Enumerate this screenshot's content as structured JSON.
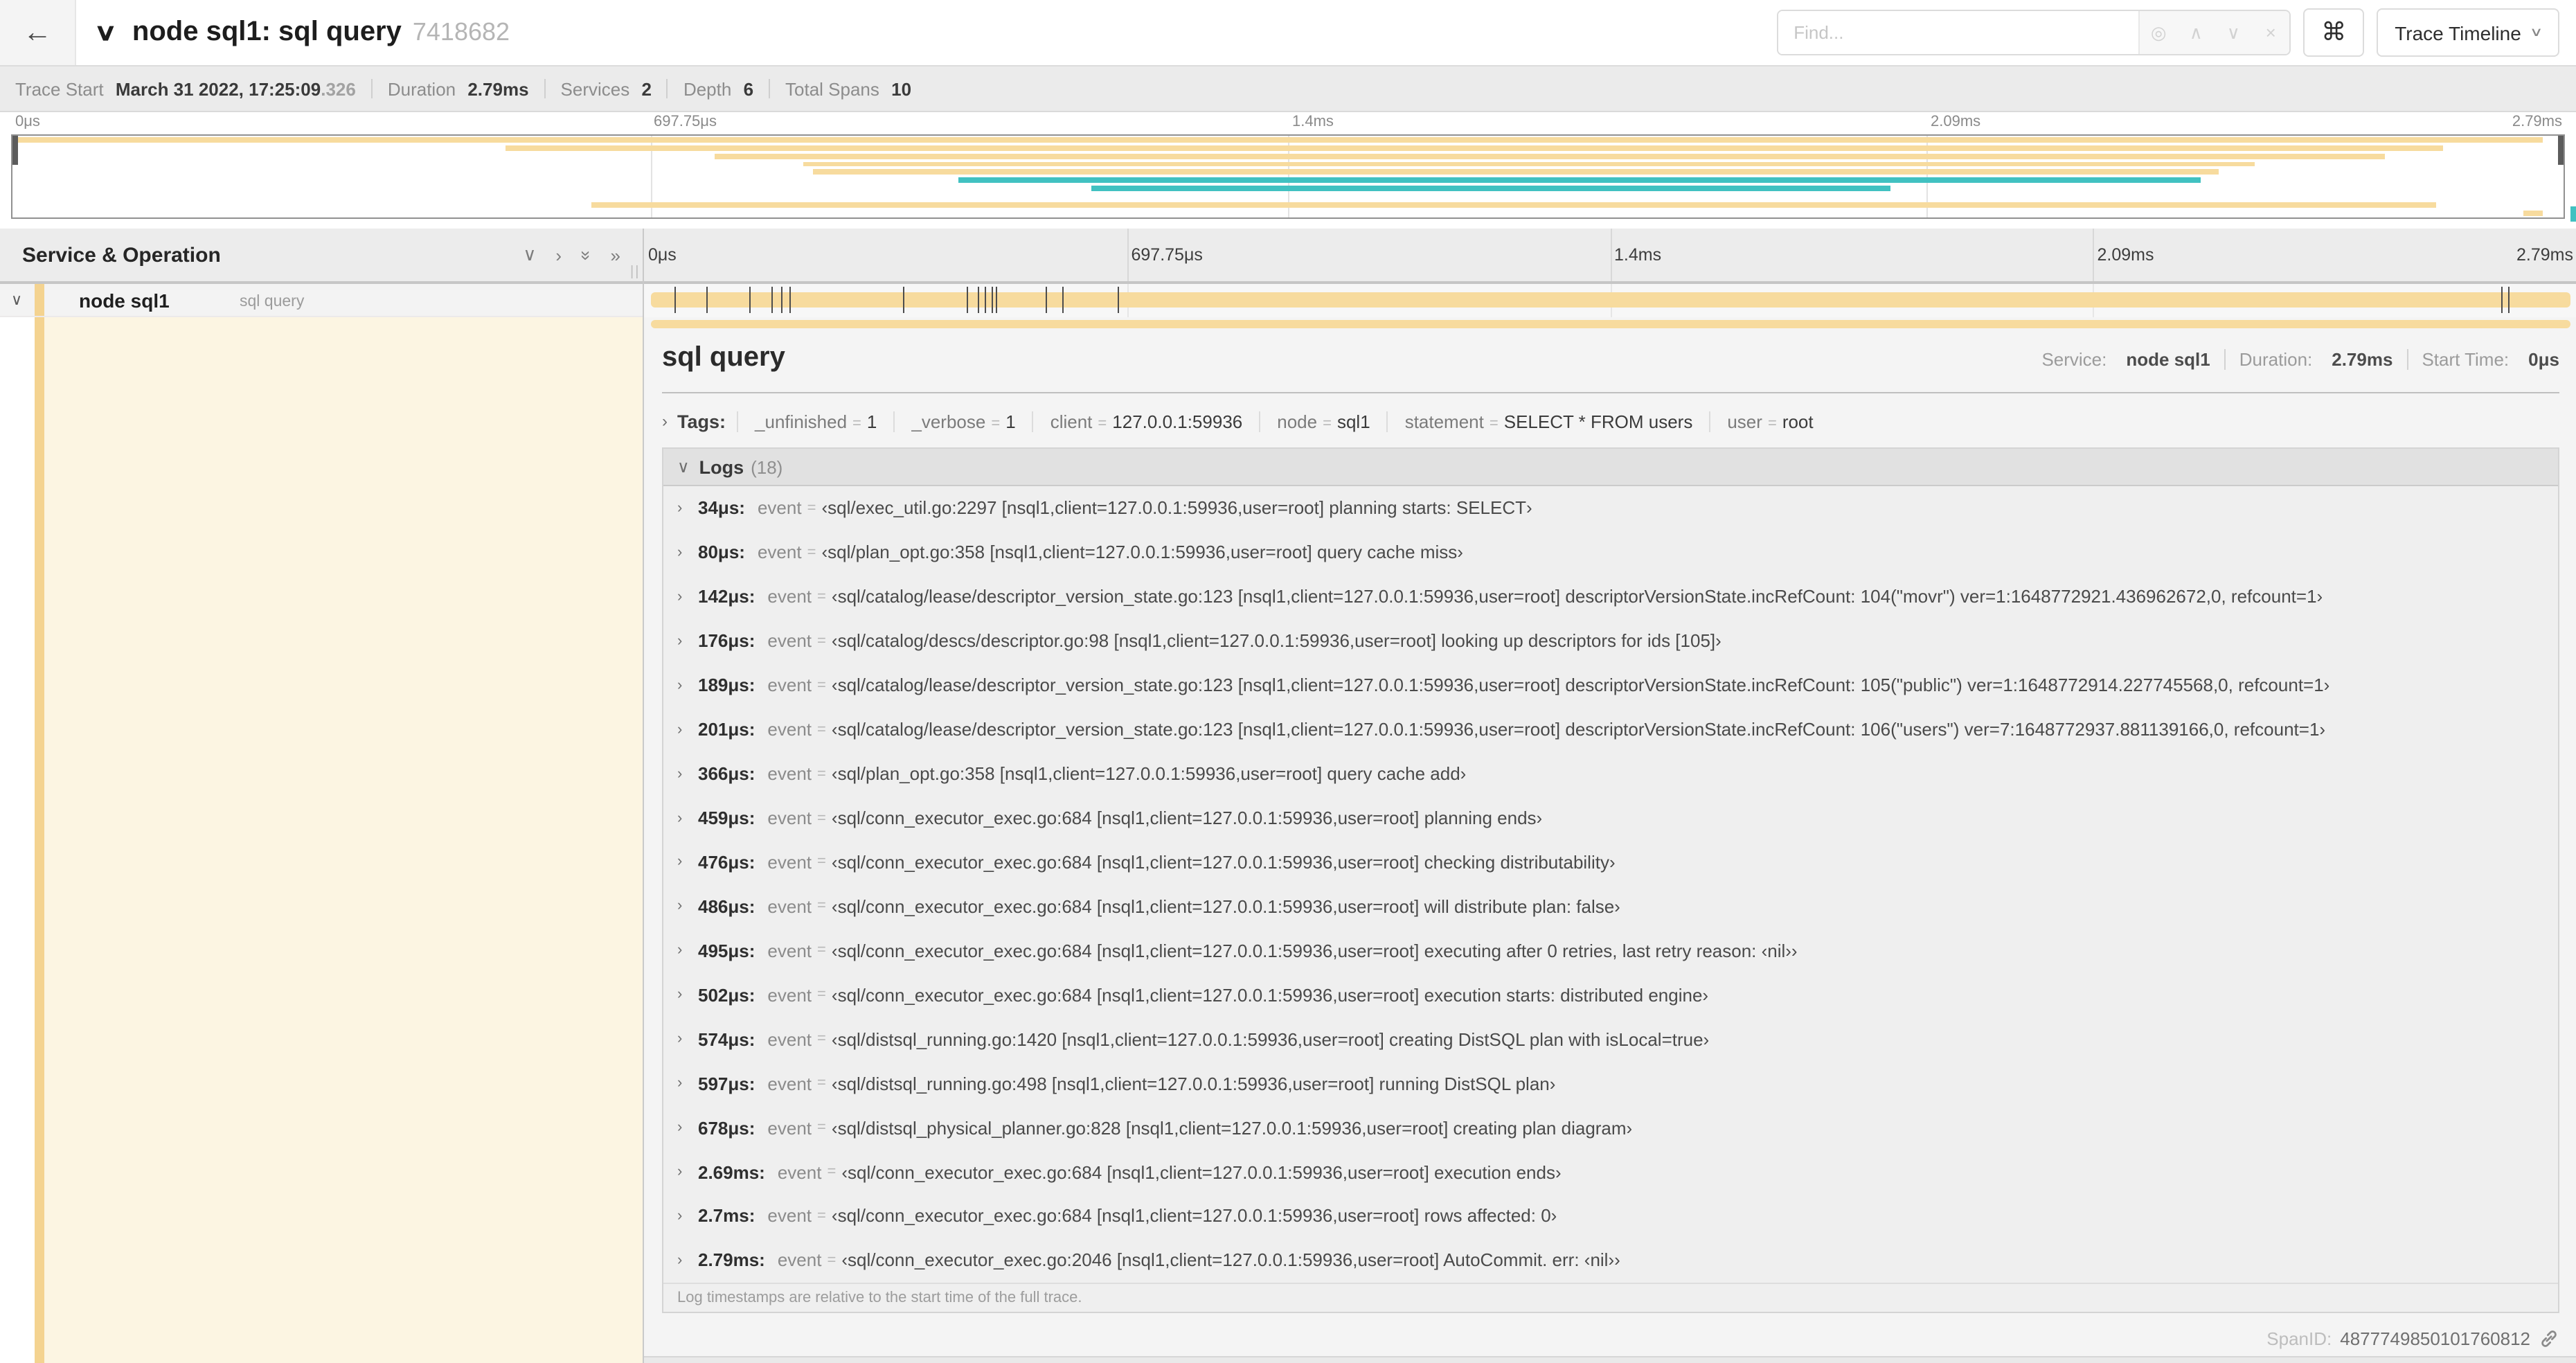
{
  "header": {
    "back_icon": "←",
    "collapse_icon": "∨",
    "title": "node sql1: sql query",
    "trace_id_short": "7418682",
    "find_placeholder": "Find...",
    "find_icons": [
      "◎",
      "∧",
      "∨",
      "×"
    ],
    "shortcut_icon": "⌘",
    "view_selector": "Trace Timeline",
    "view_caret": "∨"
  },
  "summary": {
    "items": [
      {
        "label": "Trace Start",
        "value": "March 31 2022, 17:25:09",
        "dim": ".326"
      },
      {
        "label": "Duration",
        "value": "2.79ms"
      },
      {
        "label": "Services",
        "value": "2"
      },
      {
        "label": "Depth",
        "value": "6"
      },
      {
        "label": "Total Spans",
        "value": "10"
      }
    ]
  },
  "timeline": {
    "ticks": [
      "0μs",
      "697.75μs",
      "1.4ms",
      "2.09ms",
      "2.79ms"
    ],
    "duration_us": 2790,
    "grid_fractions": [
      0.25,
      0.5,
      0.75
    ],
    "minimap_spans": [
      {
        "row": 0,
        "start": 0.0,
        "end": 0.992,
        "color": "wheat"
      },
      {
        "row": 1,
        "start": 0.193,
        "end": 0.953,
        "color": "wheat"
      },
      {
        "row": 2,
        "start": 0.275,
        "end": 0.93,
        "color": "wheat"
      },
      {
        "row": 3,
        "start": 0.31,
        "end": 0.879,
        "color": "wheat"
      },
      {
        "row": 4,
        "start": 0.314,
        "end": 0.865,
        "color": "wheat"
      },
      {
        "row": 5,
        "start": 0.371,
        "end": 0.858,
        "color": "teal"
      },
      {
        "row": 6,
        "start": 0.423,
        "end": 0.736,
        "color": "teal"
      },
      {
        "row": 8,
        "start": 0.227,
        "end": 0.95,
        "color": "wheat"
      },
      {
        "row": 9,
        "start": 0.984,
        "end": 0.992,
        "color": "wheat"
      }
    ]
  },
  "span_tree": {
    "header": "Service & Operation",
    "icons": {
      "collapse_one": "∨",
      "expand_one": "›",
      "collapse_all": "»",
      "expand_all": "»",
      "grip": "||"
    },
    "row": {
      "chevron": "∨",
      "service": "node sql1",
      "operation": "sql query"
    }
  },
  "detail": {
    "operation": "sql query",
    "meta": [
      {
        "label": "Service:",
        "value": "node sql1"
      },
      {
        "label": "Duration:",
        "value": "2.79ms"
      },
      {
        "label": "Start Time:",
        "value": "0μs"
      }
    ],
    "tags_chevron": "›",
    "tags_label": "Tags:",
    "tags": [
      {
        "key": "_unfinished",
        "value": "1"
      },
      {
        "key": "_verbose",
        "value": "1"
      },
      {
        "key": "client",
        "value": "127.0.0.1:59936"
      },
      {
        "key": "node",
        "value": "sql1"
      },
      {
        "key": "statement",
        "value": "SELECT * FROM users"
      },
      {
        "key": "user",
        "value": "root"
      }
    ],
    "logs_chevron": "∨",
    "logs_label": "Logs",
    "logs_count": "(18)",
    "log_key": "event",
    "logs": [
      {
        "time": "34μs",
        "time_us": 34,
        "value": "‹sql/exec_util.go:2297 [nsql1,client=127.0.0.1:59936,user=root] planning starts: SELECT›"
      },
      {
        "time": "80μs",
        "time_us": 80,
        "value": "‹sql/plan_opt.go:358 [nsql1,client=127.0.0.1:59936,user=root] query cache miss›"
      },
      {
        "time": "142μs",
        "time_us": 142,
        "value": "‹sql/catalog/lease/descriptor_version_state.go:123 [nsql1,client=127.0.0.1:59936,user=root] descriptorVersionState.incRefCount: 104(\"movr\") ver=1:1648772921.436962672,0, refcount=1›"
      },
      {
        "time": "176μs",
        "time_us": 176,
        "value": "‹sql/catalog/descs/descriptor.go:98 [nsql1,client=127.0.0.1:59936,user=root] looking up descriptors for ids [105]›"
      },
      {
        "time": "189μs",
        "time_us": 189,
        "value": "‹sql/catalog/lease/descriptor_version_state.go:123 [nsql1,client=127.0.0.1:59936,user=root] descriptorVersionState.incRefCount: 105(\"public\") ver=1:1648772914.227745568,0, refcount=1›"
      },
      {
        "time": "201μs",
        "time_us": 201,
        "value": "‹sql/catalog/lease/descriptor_version_state.go:123 [nsql1,client=127.0.0.1:59936,user=root] descriptorVersionState.incRefCount: 106(\"users\") ver=7:1648772937.881139166,0, refcount=1›"
      },
      {
        "time": "366μs",
        "time_us": 366,
        "value": "‹sql/plan_opt.go:358 [nsql1,client=127.0.0.1:59936,user=root] query cache add›"
      },
      {
        "time": "459μs",
        "time_us": 459,
        "value": "‹sql/conn_executor_exec.go:684 [nsql1,client=127.0.0.1:59936,user=root] planning ends›"
      },
      {
        "time": "476μs",
        "time_us": 476,
        "value": "‹sql/conn_executor_exec.go:684 [nsql1,client=127.0.0.1:59936,user=root] checking distributability›"
      },
      {
        "time": "486μs",
        "time_us": 486,
        "value": "‹sql/conn_executor_exec.go:684 [nsql1,client=127.0.0.1:59936,user=root] will distribute plan: false›"
      },
      {
        "time": "495μs",
        "time_us": 495,
        "value": "‹sql/conn_executor_exec.go:684 [nsql1,client=127.0.0.1:59936,user=root] executing after 0 retries, last retry reason: ‹nil››"
      },
      {
        "time": "502μs",
        "time_us": 502,
        "value": "‹sql/conn_executor_exec.go:684 [nsql1,client=127.0.0.1:59936,user=root] execution starts: distributed engine›"
      },
      {
        "time": "574μs",
        "time_us": 574,
        "value": "‹sql/distsql_running.go:1420 [nsql1,client=127.0.0.1:59936,user=root] creating DistSQL plan with isLocal=true›"
      },
      {
        "time": "597μs",
        "time_us": 597,
        "value": "‹sql/distsql_running.go:498 [nsql1,client=127.0.0.1:59936,user=root] running DistSQL plan›"
      },
      {
        "time": "678μs",
        "time_us": 678,
        "value": "‹sql/distsql_physical_planner.go:828 [nsql1,client=127.0.0.1:59936,user=root] creating plan diagram›"
      },
      {
        "time": "2.69ms",
        "time_us": 2690,
        "value": "‹sql/conn_executor_exec.go:684 [nsql1,client=127.0.0.1:59936,user=root] execution ends›"
      },
      {
        "time": "2.7ms",
        "time_us": 2700,
        "value": "‹sql/conn_executor_exec.go:684 [nsql1,client=127.0.0.1:59936,user=root] rows affected: 0›"
      },
      {
        "time": "2.79ms",
        "time_us": 2790,
        "value": "‹sql/conn_executor_exec.go:2046 [nsql1,client=127.0.0.1:59936,user=root] AutoCommit. err: ‹nil››"
      }
    ],
    "logs_footer": "Log timestamps are relative to the start time of the full trace.",
    "span_id_label": "SpanID:",
    "span_id": "4877749850101760812"
  },
  "colors": {
    "span_wheat": "#f7db9e",
    "span_teal": "#41c1c1"
  }
}
